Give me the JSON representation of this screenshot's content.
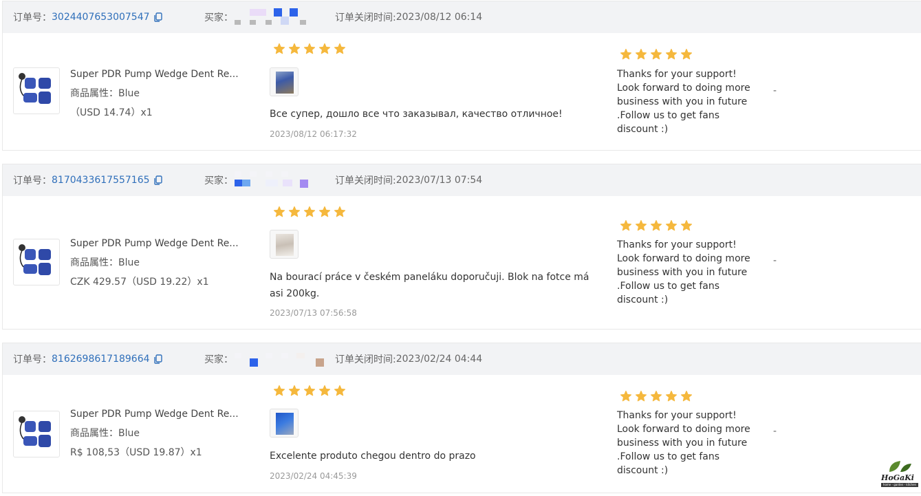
{
  "labels": {
    "order_no": "订单号：",
    "buyer": "买家：",
    "close_time_prefix": "订单关闭时间:",
    "attr_prefix": "商品属性：",
    "dash": "-"
  },
  "colors": {
    "star": "#f5b83d",
    "link": "#2f6fba",
    "header_bg": "#f2f3f5"
  },
  "orders": [
    {
      "order_no": "3024407653007547",
      "close_time": "2023/08/12 06:14",
      "product_title": "Super PDR Pump Wedge Dent Re...",
      "attr_value": "Blue",
      "price": "（USD  14.74）x1",
      "review_rating": 5,
      "seller_rating": 5,
      "review_text": "Все супер, дошло все что заказывал, качество отличное!",
      "review_time": "2023/08/12 06:17:32",
      "reply": "Thanks for your support! Look forward to doing more business with you in future .Follow us to get fans discount :)"
    },
    {
      "order_no": "8170433617557165",
      "close_time": "2023/07/13 07:54",
      "product_title": "Super PDR Pump Wedge Dent Re...",
      "attr_value": "Blue",
      "price": "CZK 429.57（USD  19.22）x1",
      "review_rating": 5,
      "seller_rating": 5,
      "review_text": "Na bourací práce v českém paneláku doporučuji. Blok na fotce má asi 200kg.",
      "review_time": "2023/07/13 07:56:58",
      "reply": "Thanks for your support! Look forward to doing more business with you in future .Follow us to get fans discount :)"
    },
    {
      "order_no": "8162698617189664",
      "close_time": "2023/02/24 04:44",
      "product_title": "Super PDR Pump Wedge Dent Re...",
      "attr_value": "Blue",
      "price": "R$ 108,53（USD  19.87）x1",
      "review_rating": 5,
      "seller_rating": 5,
      "review_text": "Excelente produto chegou dentro do prazo",
      "review_time": "2023/02/24 04:45:39",
      "reply": "Thanks for your support! Look forward to doing more business with you in future .Follow us to get fans discount :)"
    }
  ],
  "watermark": {
    "brand": "HoGaKi",
    "tagline": "home - garden - kitchen"
  }
}
